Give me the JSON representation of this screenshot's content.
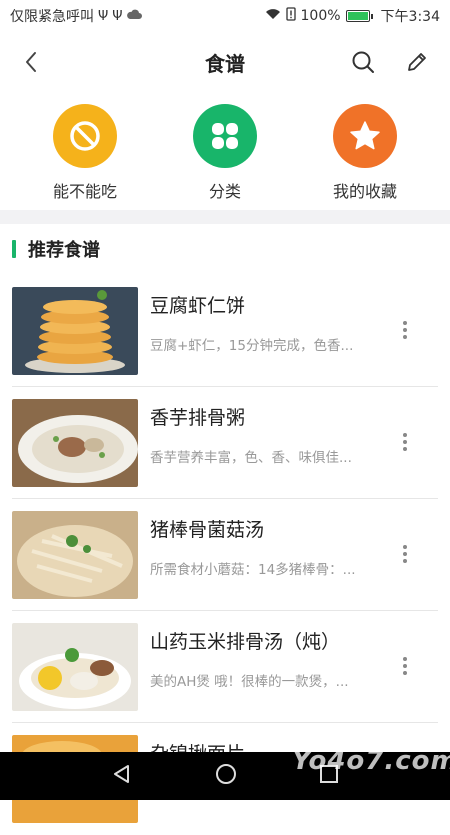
{
  "status_bar": {
    "left_text": "仅限紧急呼叫",
    "battery": "100%",
    "time": "下午3:34",
    "icons": [
      "usb-icon",
      "usb-icon",
      "cloud-icon",
      "wifi-icon",
      "alert-icon",
      "battery-icon"
    ]
  },
  "header": {
    "title": "食谱",
    "back_icon": "chevron-left-icon",
    "search_icon": "search-icon",
    "edit_icon": "pencil-icon"
  },
  "quick_actions": [
    {
      "label": "能不能吃",
      "icon": "prohibited-icon",
      "color": "#f5b21b"
    },
    {
      "label": "分类",
      "icon": "grid-icon",
      "color": "#18b56a"
    },
    {
      "label": "我的收藏",
      "icon": "star-icon",
      "color": "#f07228"
    }
  ],
  "section": {
    "title": "推荐食谱",
    "accent": "#19b46a"
  },
  "recipes": [
    {
      "name": "豆腐虾仁饼",
      "desc": "豆腐+虾仁，15分钟完成，色香..."
    },
    {
      "name": "香芋排骨粥",
      "desc": "香芋营养丰富，色、香、味俱佳..."
    },
    {
      "name": "猪棒骨菌菇汤",
      "desc": "所需食材小蘑菇：14多猪棒骨：..."
    },
    {
      "name": "山药玉米排骨汤（炖）",
      "desc": "美的AH煲 哦！很棒的一款煲，..."
    },
    {
      "name": "杂锦揪面片",
      "desc": ""
    }
  ],
  "watermark": "Yo4o7.com"
}
